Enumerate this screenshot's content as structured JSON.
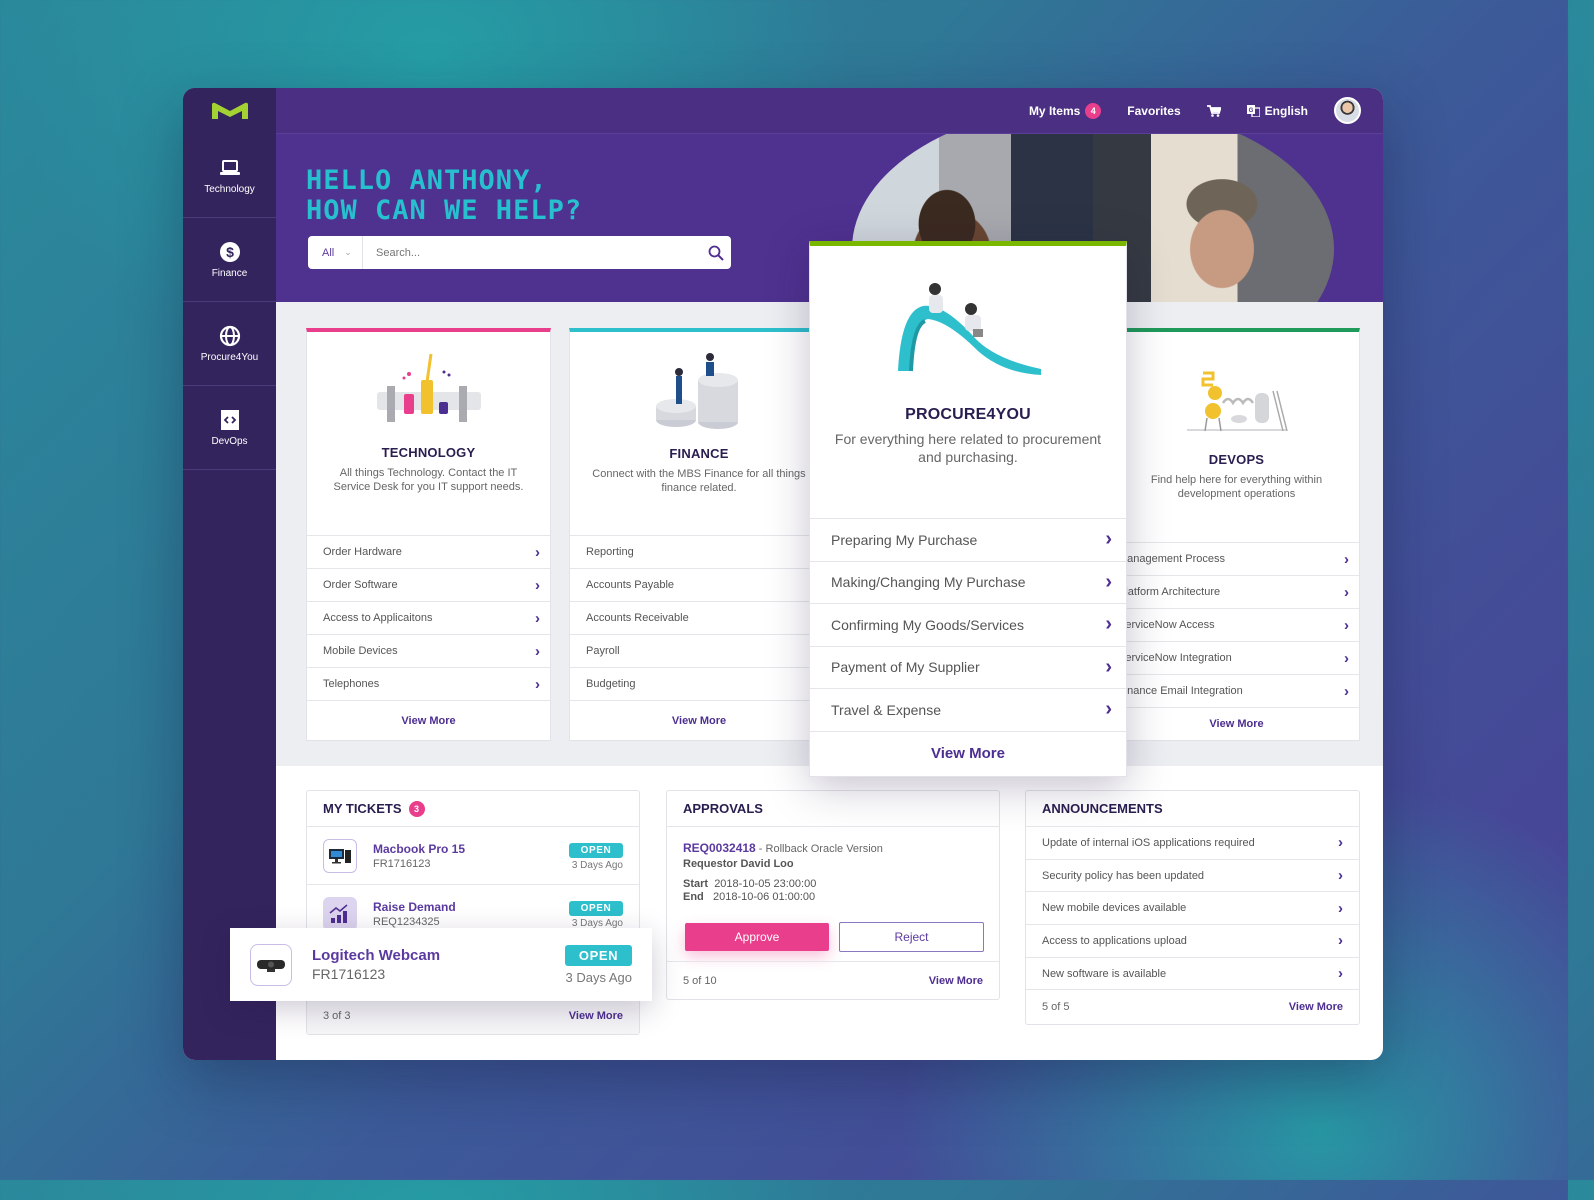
{
  "app": {
    "brand_colors": {
      "primary": "#4a2f82",
      "accent_pink": "#e83e8c",
      "accent_teal": "#2dbfcc",
      "accent_green": "#7ab800",
      "sidebar": "#34245e"
    }
  },
  "sidebar": {
    "logo_icon": "m-logo",
    "items": [
      {
        "label": "Technology",
        "icon": "laptop-icon"
      },
      {
        "label": "Finance",
        "icon": "dollar-icon"
      },
      {
        "label": "Procure4You",
        "icon": "globe-icon"
      },
      {
        "label": "DevOps",
        "icon": "code-icon"
      }
    ]
  },
  "topbar": {
    "my_items_label": "My Items",
    "my_items_count": "4",
    "favorites_label": "Favorites",
    "cart_icon": "cart-icon",
    "language_label": "English",
    "language_icon": "translate-icon",
    "avatar": "user-avatar"
  },
  "hero": {
    "title_line1": "Hello Anthony,",
    "title_line2": "How can we help?",
    "search_scope": "All",
    "search_placeholder": "Search..."
  },
  "categories": [
    {
      "title": "TECHNOLOGY",
      "description": "All things Technology. Contact the IT Service Desk for you IT support needs.",
      "accent": "#e83e8c",
      "links": [
        "Order Hardware",
        "Order Software",
        "Access to Applicaitons",
        "Mobile Devices",
        "Telephones"
      ],
      "view_more": "View More"
    },
    {
      "title": "FINANCE",
      "description": "Connect with the MBS Finance for all things finance related.",
      "accent": "#2dbfcc",
      "links": [
        "Reporting",
        "Accounts Payable",
        "Accounts Receivable",
        "Payroll",
        "Budgeting"
      ],
      "view_more": "View More"
    },
    {
      "title": "PROCURE4YOU",
      "description": "For everything here related to procurement and purchasing.",
      "accent": "#7ab800",
      "links": [
        "Preparing My Purchase",
        "Making/Changing My Purchase",
        "Confirming My Goods/Services",
        "Payment of My Supplier",
        "Travel & Expense"
      ],
      "view_more": "View More"
    },
    {
      "title": "DEVOPS",
      "description": "Find help here for everything within development operations",
      "accent": "#1f9a5a",
      "links": [
        "Management Process",
        "Platform Architecture",
        "ServiceNow Access",
        "ServiceNow Integration",
        "Finance Email Integration"
      ],
      "view_more": "View More"
    }
  ],
  "tickets": {
    "title": "MY TICKETS",
    "count": "3",
    "items": [
      {
        "name": "Macbook Pro 15",
        "id": "FR1716123",
        "status": "OPEN",
        "ago": "3 Days Ago",
        "icon": "desktop-computer-icon"
      },
      {
        "name": "Raise Demand",
        "id": "REQ1234325",
        "status": "OPEN",
        "ago": "3 Days Ago",
        "icon": "chart-trend-icon"
      },
      {
        "name": "Logitech Webcam",
        "id": "FR1716123",
        "status": "OPEN",
        "ago": "3 Days Ago",
        "icon": "webcam-icon"
      }
    ],
    "pagination": "3 of 3",
    "view_more": "View More"
  },
  "approvals": {
    "title": "APPROVALS",
    "request_id": "REQ0032418",
    "request_title": " - Rollback Oracle Version",
    "requestor": "Requestor David Loo",
    "start_label": "Start",
    "start_value": "2018-10-05 23:00:00",
    "end_label": "End",
    "end_value": "2018-10-06 01:00:00",
    "approve_label": "Approve",
    "reject_label": "Reject",
    "pagination": "5 of 10",
    "view_more": "View More"
  },
  "announcements": {
    "title": "ANNOUNCEMENTS",
    "items": [
      "Update of internal iOS applications required",
      "Security policy has been updated",
      "New mobile devices available",
      "Access to applications upload",
      "New software is available"
    ],
    "pagination": "5 of 5",
    "view_more": "View More"
  }
}
